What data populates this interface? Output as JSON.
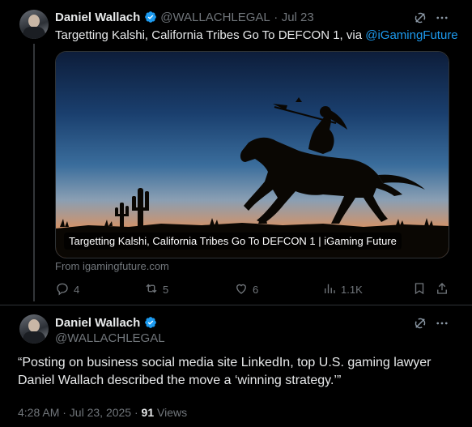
{
  "tweet1": {
    "name": "Daniel Wallach",
    "handle": "@WALLACHLEGAL",
    "dot": "·",
    "date": "Jul 23",
    "text_before": "Targetting Kalshi, California Tribes Go To DEFCON 1, via ",
    "mention": "@iGamingFuture",
    "card_caption": "Targetting Kalshi, California Tribes Go To DEFCON 1 | iGaming Future",
    "card_from": "From igamingfuture.com",
    "replies": "4",
    "reposts": "5",
    "likes": "6",
    "views": "1.1K"
  },
  "tweet2": {
    "name": "Daniel Wallach",
    "handle": "@WALLACHLEGAL",
    "quote": "“Posting on business social media site LinkedIn, top U.S. gaming lawyer Daniel Wallach described the move a ‘winning strategy.’”",
    "time": "4:28 AM · Jul 23, 2025 · ",
    "views_count": "91",
    "views_label": " Views"
  },
  "icons": [
    "grok-icon",
    "more-icon",
    "verified-badge-icon",
    "reply-icon",
    "repost-icon",
    "like-icon",
    "views-icon",
    "bookmark-icon",
    "share-icon"
  ],
  "colors": {
    "accent": "#1d9bf0",
    "background": "#000000",
    "muted": "#71767b",
    "text": "#e7e9ea"
  }
}
